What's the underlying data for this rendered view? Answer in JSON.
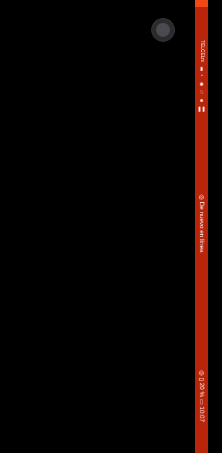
{
  "status_bar": {
    "carrier": "TELCEL",
    "network_type": "LTE",
    "icons": [
      "signal-icon",
      "wifi-icon",
      "nfc-icon",
      "data-arrows-icon",
      "square-icon",
      "pause-icon"
    ],
    "notification": "De nuevo en línea",
    "battery_percent": "20 %",
    "time": "10:07",
    "accent_color": "#b8250a",
    "top_strip_color": "#f04a12"
  }
}
